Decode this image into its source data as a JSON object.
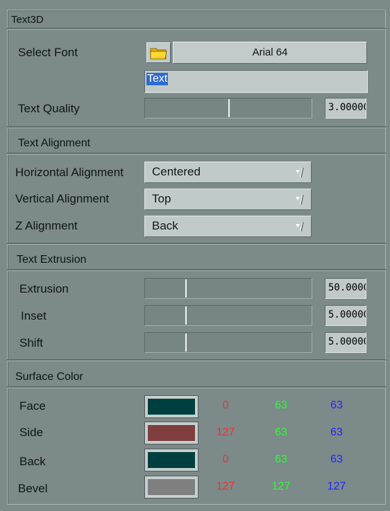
{
  "panel": {
    "title": "Text3D"
  },
  "font": {
    "label": "Select Font",
    "button_label": "Arial 64",
    "icon": "folder-icon",
    "text_value": "Text",
    "quality_label": "Text Quality",
    "quality_value": "3.00000",
    "quality_level": 0.5
  },
  "alignment": {
    "title": "Text Alignment",
    "horizontal": {
      "label": "Horizontal Alignment",
      "value": "Centered"
    },
    "vertical": {
      "label": "Vertical Alignment",
      "value": "Top"
    },
    "z": {
      "label": "Z Alignment",
      "value": "Back"
    }
  },
  "extrusion": {
    "title": "Text Extrusion",
    "extrusion": {
      "label": "Extrusion",
      "value": "50.0000",
      "level": 0.24
    },
    "inset": {
      "label": "Inset",
      "value": "5.00000",
      "level": 0.24
    },
    "shift": {
      "label": "Shift",
      "value": "5.00000",
      "level": 0.24
    }
  },
  "surface": {
    "title": "Surface Color",
    "rows": [
      {
        "label": "Face",
        "r": "0",
        "g": "63",
        "b": "63",
        "color": "#003f3f"
      },
      {
        "label": "Side",
        "r": "127",
        "g": "63",
        "b": "63",
        "color": "#7f3f3f"
      },
      {
        "label": "Back",
        "r": "0",
        "g": "63",
        "b": "63",
        "color": "#003f3f"
      },
      {
        "label": "Bevel",
        "r": "127",
        "g": "127",
        "b": "127",
        "color": "#7f7f7f"
      }
    ]
  },
  "colors": {
    "background": "#7c8a8a",
    "red_channel": "#ff2a2a",
    "green_channel": "#2dff2d",
    "blue_channel": "#2323ff",
    "selection": "#2f6ad0"
  }
}
